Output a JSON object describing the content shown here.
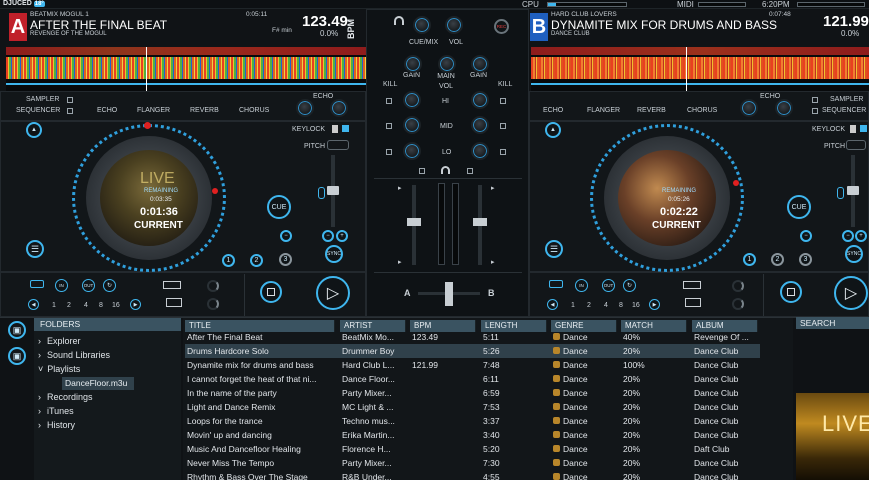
{
  "brand": "DJUCED",
  "brand_sup": "18°",
  "system": {
    "cpu_label": "CPU",
    "midi_label": "MIDI",
    "time": "6:20PM"
  },
  "deckA": {
    "letter": "A",
    "artist": "BEATMIX MOGUL 1",
    "title": "AFTER THE FINAL BEAT",
    "album": "REVENGE OF THE MOGUL",
    "elapsed": "0:05:11",
    "bpm": "123.49",
    "pitch_pct": "0.0%",
    "key": "F# min",
    "bpm_label": "BPM",
    "remaining_label": "REMAINING",
    "remaining": "0:03:35",
    "current": "0:01:36",
    "current_label": "CURRENT",
    "disc_text": "LIVE",
    "fx": [
      "ECHO",
      "FLANGER",
      "REVERB",
      "CHORUS"
    ],
    "sampler": "SAMPLER",
    "sequencer": "SEQUENCER",
    "echo_label": "ECHO",
    "keylock": "KEYLOCK",
    "pitch_label": "PITCH",
    "cue": "CUE",
    "sync": "SYNC",
    "hotcues": [
      "1",
      "2",
      "3"
    ],
    "loop_sizes": [
      "1",
      "2",
      "4",
      "8",
      "16"
    ],
    "in_label": "IN",
    "out_label": "OUT"
  },
  "deckB": {
    "letter": "B",
    "artist": "HARD CLUB LOVERS",
    "title": "DYNAMITE MIX FOR DRUMS AND BASS",
    "album": "DANCE CLUB",
    "elapsed": "0:07:48",
    "bpm": "121.99",
    "pitch_pct": "0.0%",
    "remaining_label": "REMAINING",
    "remaining": "0:05:26",
    "current": "0:02:22",
    "current_label": "CURRENT",
    "fx": [
      "ECHO",
      "FLANGER",
      "REVERB",
      "CHORUS"
    ],
    "sampler": "SAMPLER",
    "sequencer": "SEQUENCER",
    "echo_label": "ECHO",
    "keylock": "KEYLOCK",
    "pitch_label": "PITCH",
    "cue": "CUE",
    "sync": "SYNC",
    "hotcues": [
      "1",
      "2",
      "3"
    ],
    "loop_sizes": [
      "1",
      "2",
      "4",
      "8",
      "16"
    ],
    "in_label": "IN",
    "out_label": "OUT"
  },
  "mixer": {
    "cue_mix": "CUE/MIX",
    "vol": "VOL",
    "rec": "REC",
    "kill": "KILL",
    "gain": "GAIN",
    "main_vol": "MAIN VOL",
    "hi": "HI",
    "mid": "MID",
    "lo": "LO",
    "cross_a": "A",
    "cross_b": "B"
  },
  "browser": {
    "folders_header": "FOLDERS",
    "folders": [
      "Explorer",
      "Sound Libraries",
      "Playlists",
      "Recordings",
      "iTunes",
      "History"
    ],
    "playlist_item": "DanceFloor.m3u",
    "search_label": "SEARCH",
    "artwork_text": "LIVE",
    "columns": [
      "TITLE",
      "ARTIST",
      "BPM",
      "LENGTH",
      "GENRE",
      "MATCH",
      "ALBUM"
    ],
    "tracks": [
      {
        "title": "After The Final Beat",
        "artist": "BeatMix Mo...",
        "bpm": "123.49",
        "length": "5:11",
        "genre": "Dance",
        "match": "40%",
        "album": "Revenge Of ..."
      },
      {
        "title": "Drums Hardcore Solo",
        "artist": "Drummer Boy",
        "bpm": "",
        "length": "5:26",
        "genre": "Dance",
        "match": "20%",
        "album": "Dance Club"
      },
      {
        "title": "Dynamite mix for drums and bass",
        "artist": "Hard Club L...",
        "bpm": "121.99",
        "length": "7:48",
        "genre": "Dance",
        "match": "100%",
        "album": "Dance Club"
      },
      {
        "title": "I cannot forget the heat of that ni...",
        "artist": "Dance Floor...",
        "bpm": "",
        "length": "6:11",
        "genre": "Dance",
        "match": "20%",
        "album": "Dance Club"
      },
      {
        "title": "In the name of the party",
        "artist": "Party Mixer...",
        "bpm": "",
        "length": "6:59",
        "genre": "Dance",
        "match": "20%",
        "album": "Dance Club"
      },
      {
        "title": "Light and Dance Remix",
        "artist": "MC Light & ...",
        "bpm": "",
        "length": "7:53",
        "genre": "Dance",
        "match": "20%",
        "album": "Dance Club"
      },
      {
        "title": "Loops for the trance",
        "artist": "Techno mus...",
        "bpm": "",
        "length": "3:37",
        "genre": "Dance",
        "match": "20%",
        "album": "Dance Club"
      },
      {
        "title": "Movin' up and dancing",
        "artist": "Erika Martin...",
        "bpm": "",
        "length": "3:40",
        "genre": "Dance",
        "match": "20%",
        "album": "Dance Club"
      },
      {
        "title": "Music And Dancefloor Healing",
        "artist": "Florence H...",
        "bpm": "",
        "length": "5:20",
        "genre": "Dance",
        "match": "20%",
        "album": "Daft Club"
      },
      {
        "title": "Never Miss The Tempo",
        "artist": "Party Mixer...",
        "bpm": "",
        "length": "7:30",
        "genre": "Dance",
        "match": "20%",
        "album": "Dance Club"
      },
      {
        "title": "Rhythm & Bass Over The Stage",
        "artist": "R&B Under...",
        "bpm": "",
        "length": "4:55",
        "genre": "Dance",
        "match": "20%",
        "album": "Dance Club"
      }
    ]
  },
  "colors": {
    "accent": "#3fb6ee",
    "deckA": "#c0202a",
    "deckB": "#1f5fbf",
    "genre_dot": "#b8862a"
  },
  "icons": [
    "headphones-icon",
    "play-icon",
    "stop-icon",
    "loop-icon",
    "list-icon",
    "eject-icon",
    "chevron-right-icon"
  ]
}
